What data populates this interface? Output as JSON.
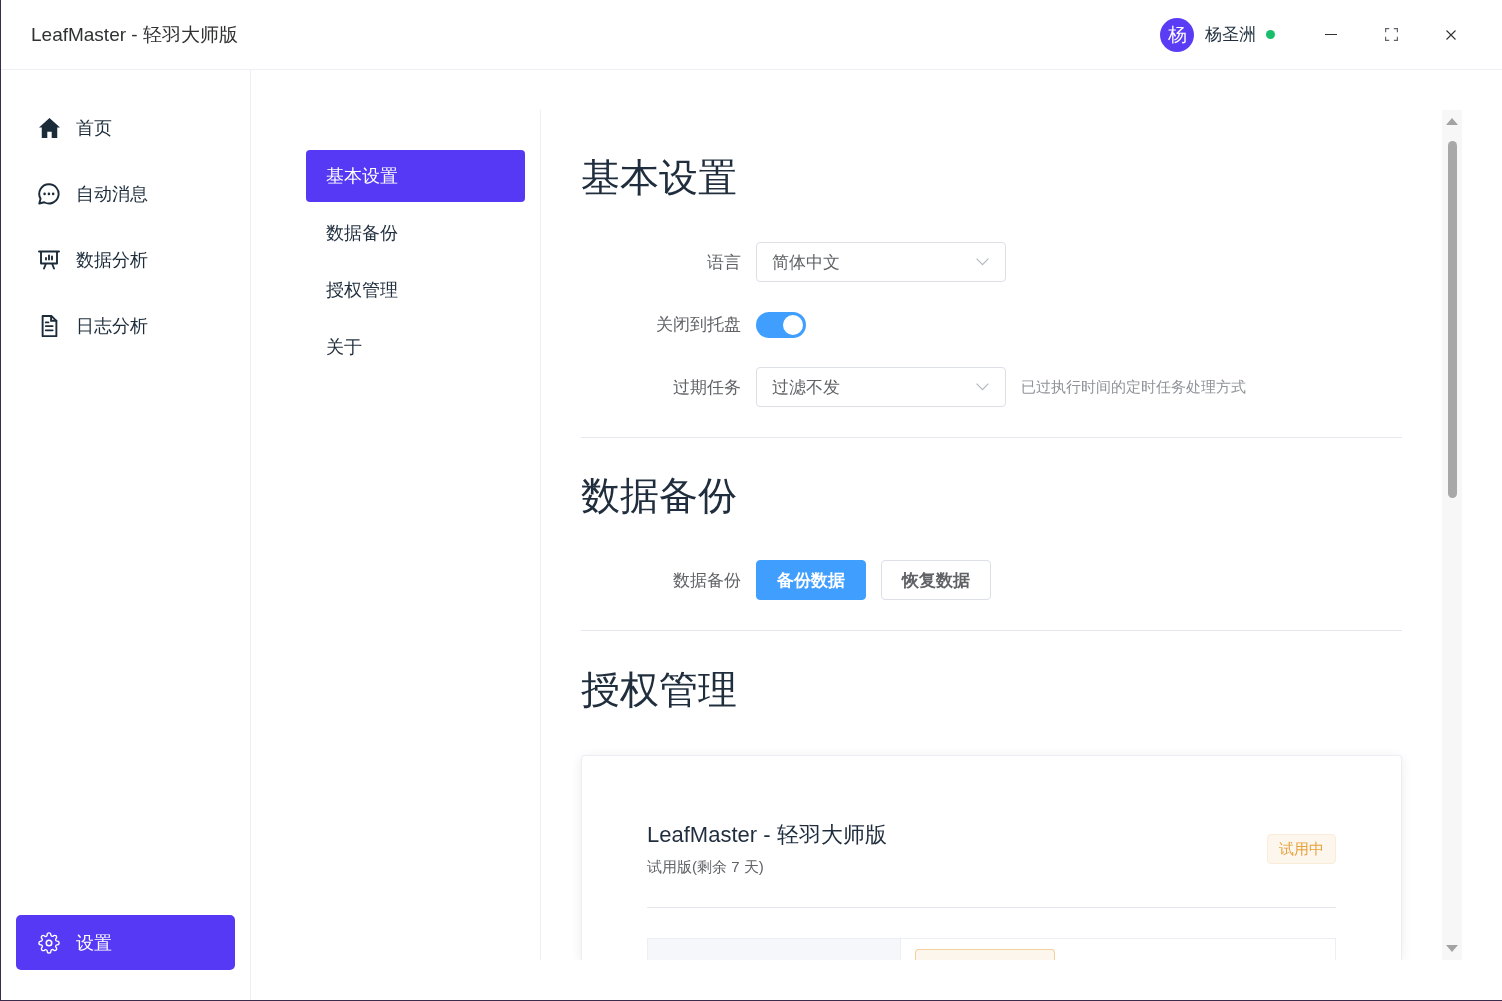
{
  "window": {
    "title": "LeafMaster - 轻羽大师版",
    "user": {
      "avatar": "杨",
      "name": "杨圣洲",
      "online": true
    }
  },
  "sidebar": {
    "items": [
      {
        "label": "首页",
        "selected": false
      },
      {
        "label": "自动消息",
        "selected": false
      },
      {
        "label": "数据分析",
        "selected": false
      },
      {
        "label": "日志分析",
        "selected": false
      }
    ],
    "bottom_item": {
      "label": "设置",
      "selected": true
    }
  },
  "settings_nav": [
    {
      "label": "基本设置",
      "selected": true
    },
    {
      "label": "数据备份",
      "selected": false
    },
    {
      "label": "授权管理",
      "selected": false
    },
    {
      "label": "关于",
      "selected": false
    }
  ],
  "sections": [
    {
      "kind": "form",
      "title": "基本设置",
      "fields": [
        {
          "kind": "select",
          "label": "语言",
          "value": "简体中文"
        },
        {
          "kind": "switch",
          "label": "关闭到托盘",
          "on": true
        },
        {
          "kind": "select",
          "label": "过期任务",
          "value": "过滤不发",
          "hint": "已过执行时间的定时任务处理方式"
        }
      ]
    },
    {
      "kind": "form",
      "title": "数据备份",
      "fields": [
        {
          "kind": "buttons",
          "label": "数据备份",
          "buttons": [
            {
              "label": "备份数据",
              "kind": "primary"
            },
            {
              "label": "恢复数据",
              "kind": "default"
            }
          ]
        }
      ]
    },
    {
      "kind": "license",
      "title": "授权管理",
      "card": {
        "product": "LeafMaster - 轻羽大师版",
        "subtitle": "试用版(剩余 7 天)",
        "status": {
          "label": "试用中",
          "kind": "warning"
        }
      }
    }
  ]
}
